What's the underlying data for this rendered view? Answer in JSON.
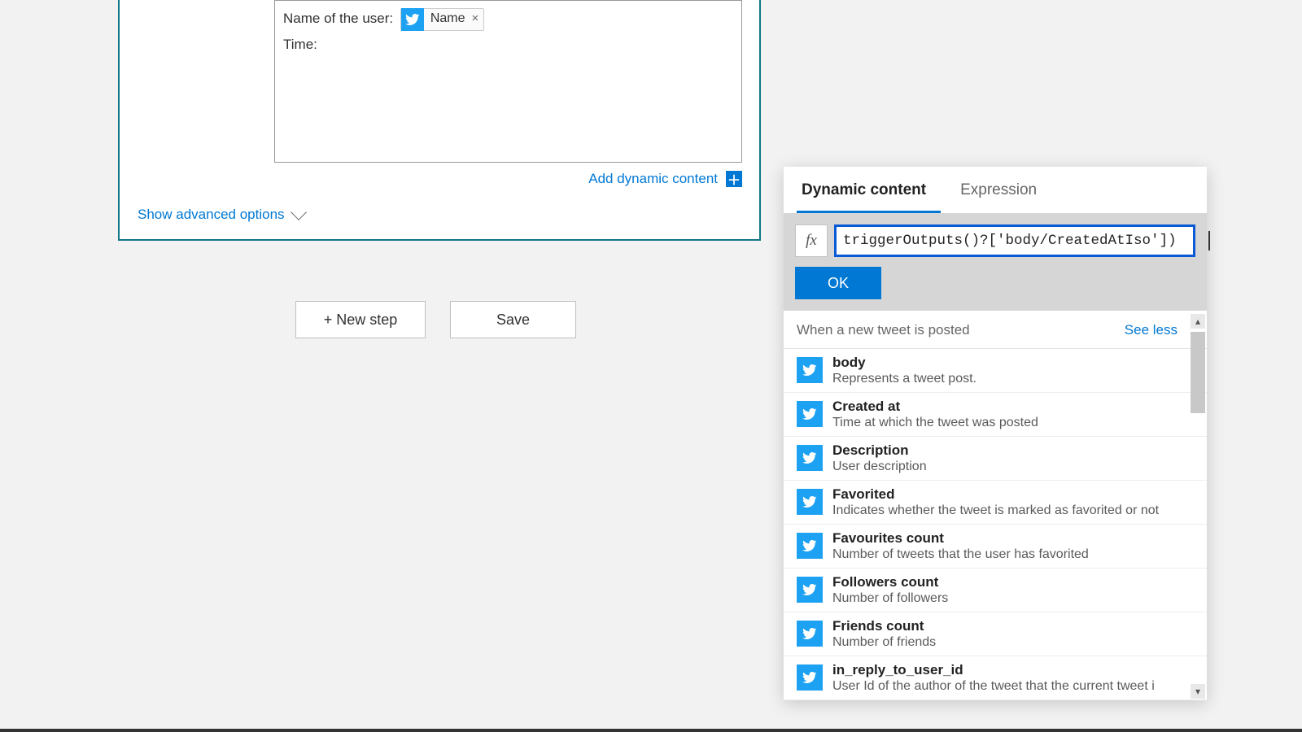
{
  "card": {
    "line1_label": "Name of the user: ",
    "token_label": "Name",
    "line2_label": "Time:",
    "add_dynamic": "Add dynamic content",
    "show_advanced": "Show advanced options"
  },
  "actions": {
    "new_step": "+ New step",
    "save": "Save"
  },
  "panel": {
    "tab_dynamic": "Dynamic content",
    "tab_expression": "Expression",
    "fx": "fx",
    "expression_value": "triggerOutputs()?['body/CreatedAtIso'])",
    "ok": "OK",
    "group_title": "When a new tweet is posted",
    "see_less": "See less",
    "items": [
      {
        "title": "body",
        "desc": "Represents a tweet post."
      },
      {
        "title": "Created at",
        "desc": "Time at which the tweet was posted"
      },
      {
        "title": "Description",
        "desc": "User description"
      },
      {
        "title": "Favorited",
        "desc": "Indicates whether the tweet is marked as favorited or not"
      },
      {
        "title": "Favourites count",
        "desc": "Number of tweets that the user has favorited"
      },
      {
        "title": "Followers count",
        "desc": "Number of followers"
      },
      {
        "title": "Friends count",
        "desc": "Number of friends"
      },
      {
        "title": "in_reply_to_user_id",
        "desc": "User Id of the author of the tweet that the current tweet i"
      }
    ]
  }
}
